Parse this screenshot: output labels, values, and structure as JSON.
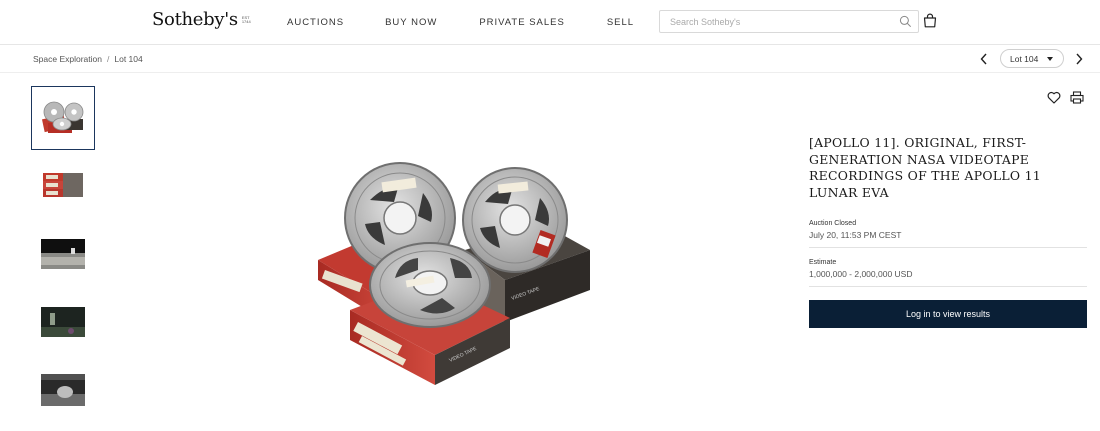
{
  "brand": {
    "name": "Sotheby's",
    "est_lines": [
      "EST",
      "1744"
    ]
  },
  "nav": {
    "items": [
      {
        "label": "AUCTIONS"
      },
      {
        "label": "BUY NOW"
      },
      {
        "label": "PRIVATE SALES"
      },
      {
        "label": "SELL"
      }
    ]
  },
  "search": {
    "placeholder": "Search Sotheby's",
    "value": "",
    "icon": "search-icon"
  },
  "cart": {
    "icon": "shopping-bag-icon"
  },
  "breadcrumb": {
    "items": [
      "Space Exploration",
      "Lot 104"
    ],
    "separator": "/"
  },
  "lot_nav": {
    "selected": "Lot 104",
    "prev_icon": "chevron-left-icon",
    "next_icon": "chevron-right-icon"
  },
  "thumbnails": {
    "count": 5,
    "active_index": 0,
    "items": [
      "videotape reels",
      "stacked tape boxes",
      "lunar surface still",
      "lunar surface still (dark)",
      "astronaut still"
    ]
  },
  "lot": {
    "title": "[APOLLO 11]. ORIGINAL, FIRST-GENERATION NASA VIDEOTAPE RECORDINGS OF THE APOLLO 11 LUNAR EVA",
    "status_label": "Auction Closed",
    "status_value": "July 20, 11:53 PM CEST",
    "estimate_label": "Estimate",
    "estimate_value": "1,000,000 - 2,000,000 USD",
    "cta_label": "Log in to view results"
  },
  "actions": {
    "favorite_icon": "heart-icon",
    "print_icon": "printer-icon"
  },
  "colors": {
    "accent_dark": "#0a1f36",
    "active_thumb_border": "#1b365d",
    "tape_box_red": "#c0392b"
  }
}
